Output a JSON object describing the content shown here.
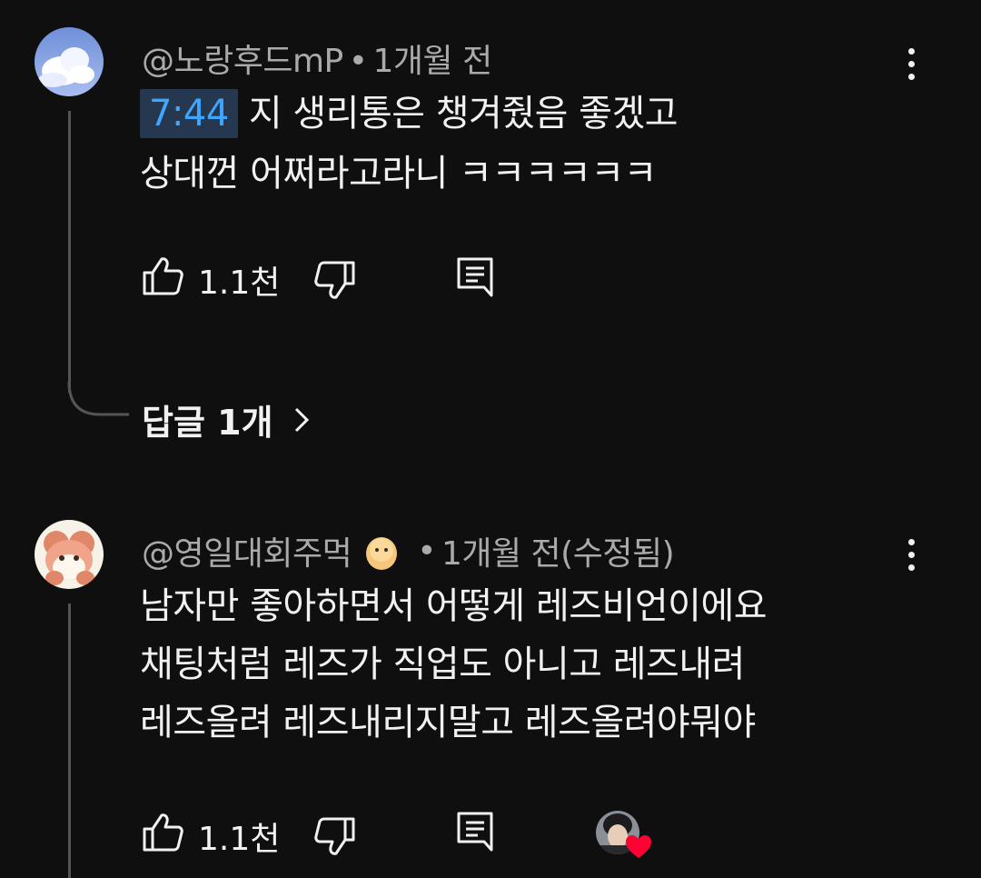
{
  "comments": [
    {
      "author": "@노랑후드mP",
      "meta": "1개월 전",
      "timestamp": "7:44",
      "line1": "지 생리통은 챙겨줬음 좋겠고",
      "line2": "상대껀 어쩌라고라니 ㅋㅋㅋㅋㅋㅋ",
      "likes": "1.1천",
      "replies_label": "답글 1개"
    },
    {
      "author": "@영일대회주먹",
      "meta": "1개월 전(수정됨)",
      "line1": "남자만 좋아하면서 어떻게 레즈비언이에요",
      "line2": "채팅처럼 레즈가 직업도 아니고 레즈내려",
      "line3": "레즈올려 레즈내리지말고 레즈올려야뭐야",
      "likes": "1.1천"
    }
  ],
  "icons": {
    "like": "thumb-up-icon",
    "dislike": "thumb-down-icon",
    "reply": "reply-comment-icon",
    "more": "more-vertical-icon",
    "chevron": "chevron-right-icon",
    "heart": "heart-icon"
  },
  "colors": {
    "background": "#0f0f0f",
    "timestamp_link": "#3ea6ff",
    "heart": "#ff0033"
  }
}
